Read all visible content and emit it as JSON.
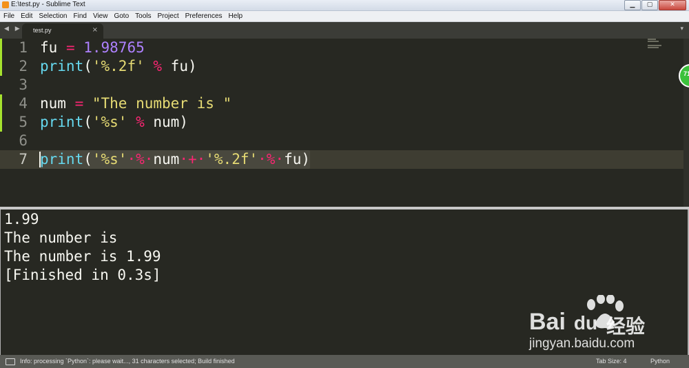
{
  "window": {
    "title": "E:\\test.py - Sublime Text",
    "buttons": {
      "minimize": "▁",
      "maximize": "▢",
      "close": "✕"
    }
  },
  "menu": [
    "File",
    "Edit",
    "Selection",
    "Find",
    "View",
    "Goto",
    "Tools",
    "Project",
    "Preferences",
    "Help"
  ],
  "tabs": {
    "nav_arrows": "◀ ▶",
    "active_tab": "test.py",
    "close_glyph": "×",
    "dropdown_glyph": "▾"
  },
  "editor": {
    "line_numbers": [
      "1",
      "2",
      "3",
      "4",
      "5",
      "6",
      "7"
    ],
    "lines": [
      {
        "t1": "fu",
        "t2": " = ",
        "t3": "1.98765"
      },
      {
        "t1": "print",
        "t2": "(",
        "t3": "'%.2f'",
        "t4": " % ",
        "t5": "fu)"
      },
      {},
      {
        "t1": "num",
        "t2": " = ",
        "t3": "\"The number is \""
      },
      {
        "t1": "print",
        "t2": "(",
        "t3": "'%s'",
        "t4": " % ",
        "t5": "num)"
      },
      {},
      {
        "t1": "print",
        "t2": "(",
        "t3": "'%s'",
        "t4": "·%·",
        "t5": "num",
        "t6": "·+·",
        "t7": "'%.2f'",
        "t8": "·%·",
        "t9": "fu)"
      }
    ]
  },
  "output": {
    "lines": [
      "1.99",
      "The number is ",
      "The number is 1.99",
      "[Finished in 0.3s]"
    ]
  },
  "badge": {
    "text": "71"
  },
  "watermark": {
    "brand": "Bai",
    "brand2": "du",
    "cn": "经验",
    "url": "jingyan.baidu.com"
  },
  "status": {
    "message": "Info: processing `Python`: please wait..., 31 characters selected; Build finished",
    "tab_size": "Tab Size: 4",
    "syntax": "Python"
  },
  "colors": {
    "background": "#272822",
    "keyword": "#f92672",
    "function": "#66d9ef",
    "string": "#e6db74",
    "number": "#ae81ff"
  }
}
